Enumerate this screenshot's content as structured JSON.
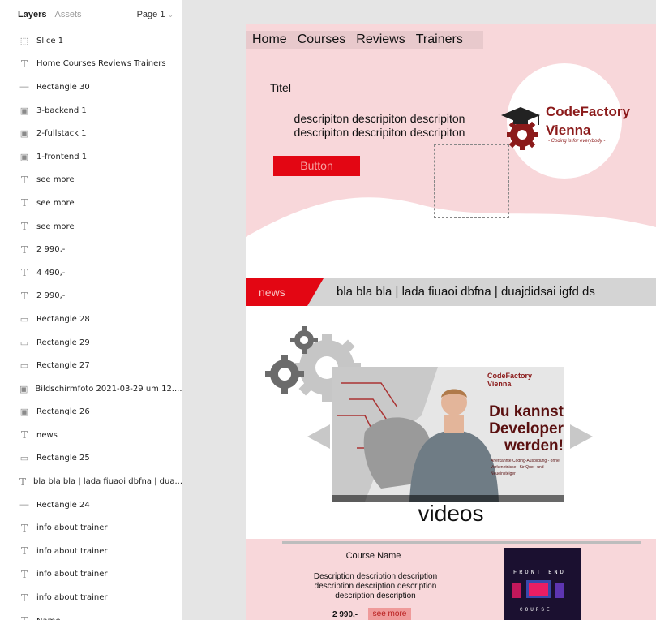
{
  "panel": {
    "tab_layers": "Layers",
    "tab_assets": "Assets",
    "page_select": "Page 1",
    "layers": [
      {
        "icon": "slice-icon",
        "glyph": "⬚",
        "name": "Slice 1"
      },
      {
        "icon": "text-icon",
        "glyph": "T",
        "name": "Home Courses Reviews Trainers"
      },
      {
        "icon": "line-icon",
        "glyph": "—",
        "name": "Rectangle 30"
      },
      {
        "icon": "image-icon",
        "glyph": "▣",
        "name": "3-backend 1"
      },
      {
        "icon": "image-icon",
        "glyph": "▣",
        "name": "2-fullstack 1"
      },
      {
        "icon": "image-icon",
        "glyph": "▣",
        "name": "1-frontend 1"
      },
      {
        "icon": "text-icon",
        "glyph": "T",
        "name": "see more"
      },
      {
        "icon": "text-icon",
        "glyph": "T",
        "name": "see more"
      },
      {
        "icon": "text-icon",
        "glyph": "T",
        "name": "see more"
      },
      {
        "icon": "text-icon",
        "glyph": "T",
        "name": "2 990,-"
      },
      {
        "icon": "text-icon",
        "glyph": "T",
        "name": "4 490,-"
      },
      {
        "icon": "text-icon",
        "glyph": "T",
        "name": "2 990,-"
      },
      {
        "icon": "rectangle-icon",
        "glyph": "▭",
        "name": "Rectangle 28"
      },
      {
        "icon": "rectangle-icon",
        "glyph": "▭",
        "name": "Rectangle 29"
      },
      {
        "icon": "rectangle-icon",
        "glyph": "▭",
        "name": "Rectangle 27"
      },
      {
        "icon": "image-icon",
        "glyph": "▣",
        "name": "Bildschirmfoto 2021-03-29 um 12...."
      },
      {
        "icon": "image-icon",
        "glyph": "▣",
        "name": "Rectangle 26"
      },
      {
        "icon": "text-icon",
        "glyph": "T",
        "name": "news"
      },
      {
        "icon": "rectangle-icon",
        "glyph": "▭",
        "name": "Rectangle 25"
      },
      {
        "icon": "text-icon",
        "glyph": "T",
        "name": "bla bla bla | lada fiuaoi dbfna | dua..."
      },
      {
        "icon": "line-icon",
        "glyph": "—",
        "name": "Rectangle 24"
      },
      {
        "icon": "text-icon",
        "glyph": "T",
        "name": "info about trainer"
      },
      {
        "icon": "text-icon",
        "glyph": "T",
        "name": "info about trainer"
      },
      {
        "icon": "text-icon",
        "glyph": "T",
        "name": "info about trainer"
      },
      {
        "icon": "text-icon",
        "glyph": "T",
        "name": "info about trainer"
      },
      {
        "icon": "text-icon",
        "glyph": "T",
        "name": "Name"
      }
    ]
  },
  "design": {
    "nav": [
      "Home",
      "Courses",
      "Reviews",
      "Trainers"
    ],
    "hero_title": "Titel",
    "hero_desc_line1": "descripiton descripiton descripiton",
    "hero_desc_line2": "descripiton descripiton descripiton",
    "hero_button": "Button",
    "logo_line1": "CodeFactory",
    "logo_line2": "Vienna",
    "logo_tagline": "- Coding is for everybody -",
    "news_label": "news",
    "news_ticker": "bla bla bla   |   lada fiuaoi dbfna   |   duajdidsai igfd ds",
    "video_logo_line1": "CodeFactory",
    "video_logo_line2": "Vienna",
    "video_headline": "Du kannst Developer werden!",
    "video_sub": "Anerkannte Coding-Ausbildung - ohne Vorkenntnisse - für Quer- und Neueinsteiger",
    "videos_label": "videos",
    "course_name": "Course Name",
    "course_desc": "Description description description description description description description description",
    "course_price": "2 990,-",
    "course_more": "see more",
    "course_image_top": "FRONT END",
    "course_image_bottom": "COURSE"
  },
  "colors": {
    "hero_bg": "#f8d7da",
    "accent_red": "#e30613",
    "news_bg": "#d4d4d4",
    "brand_dark_red": "#8b1a1a"
  }
}
